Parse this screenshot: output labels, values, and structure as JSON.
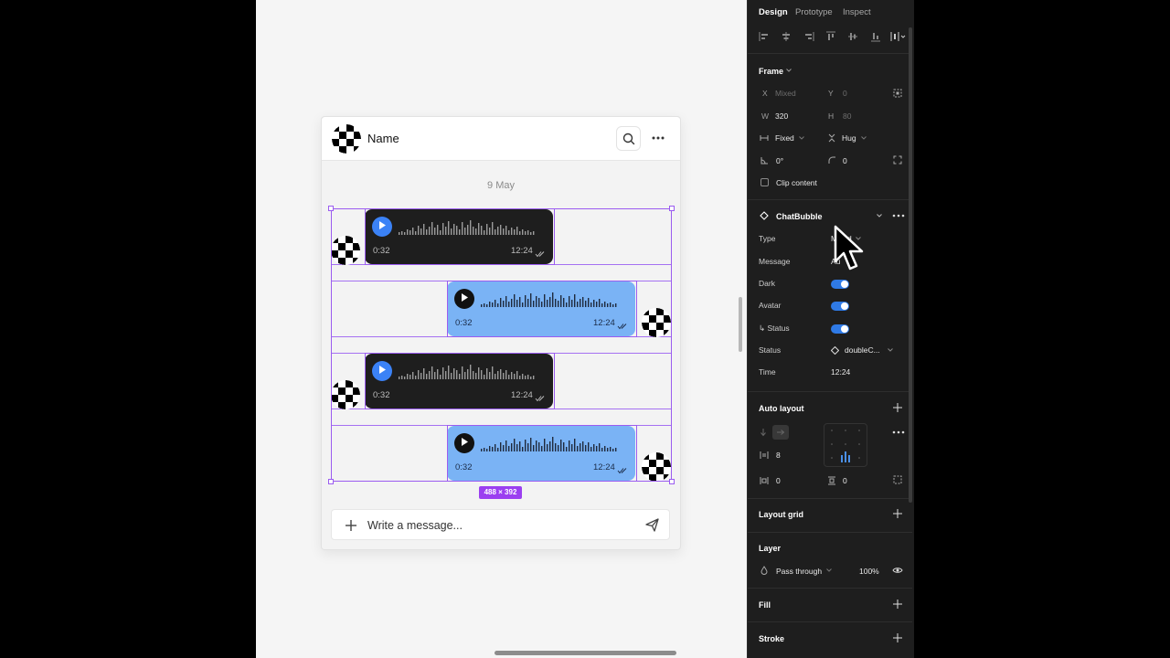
{
  "chat": {
    "name": "Name",
    "date": "9 May",
    "composer_placeholder": "Write a message...",
    "selection_size": "488 × 392",
    "messages": [
      {
        "side": "left",
        "theme": "dark",
        "duration": "0:32",
        "time": "12:24"
      },
      {
        "side": "right",
        "theme": "light",
        "duration": "0:32",
        "time": "12:24"
      },
      {
        "side": "left",
        "theme": "dark",
        "duration": "0:32",
        "time": "12:24"
      },
      {
        "side": "right",
        "theme": "light",
        "duration": "0:32",
        "time": "12:24"
      }
    ]
  },
  "panel": {
    "tabs": [
      "Design",
      "Prototype",
      "Inspect"
    ],
    "frame": {
      "title": "Frame",
      "x_label": "X",
      "x_value": "Mixed",
      "y_label": "Y",
      "y_value": "0",
      "w_label": "W",
      "w_value": "320",
      "h_label": "H",
      "h_value": "80",
      "width_mode": "Fixed",
      "height_mode": "Hug",
      "rotation": "0°",
      "radius": "0",
      "clip_content": "Clip content"
    },
    "component": {
      "name": "ChatBubble",
      "props": [
        {
          "label": "Type",
          "value": "Mixed"
        },
        {
          "label": "Message",
          "value": "Au"
        },
        {
          "label": "Dark",
          "toggle": true
        },
        {
          "label": "Avatar",
          "toggle": true
        },
        {
          "label": "↳ Status",
          "toggle": true
        },
        {
          "label": "Status",
          "value": "doubleC..."
        },
        {
          "label": "Time",
          "value": "12:24"
        }
      ]
    },
    "auto_layout": {
      "title": "Auto layout",
      "spacing": "8",
      "padding_h": "0",
      "padding_v": "0"
    },
    "layout_grid": "Layout grid",
    "layer": {
      "title": "Layer",
      "blend": "Pass through",
      "opacity": "100%"
    },
    "fill": "Fill",
    "stroke": "Stroke"
  },
  "colors": {
    "accent": "#9b5cf0",
    "toggle": "#2f7ae6",
    "dark_bubble": "#1e1e1e",
    "light_bubble": "#7ab3f5"
  }
}
